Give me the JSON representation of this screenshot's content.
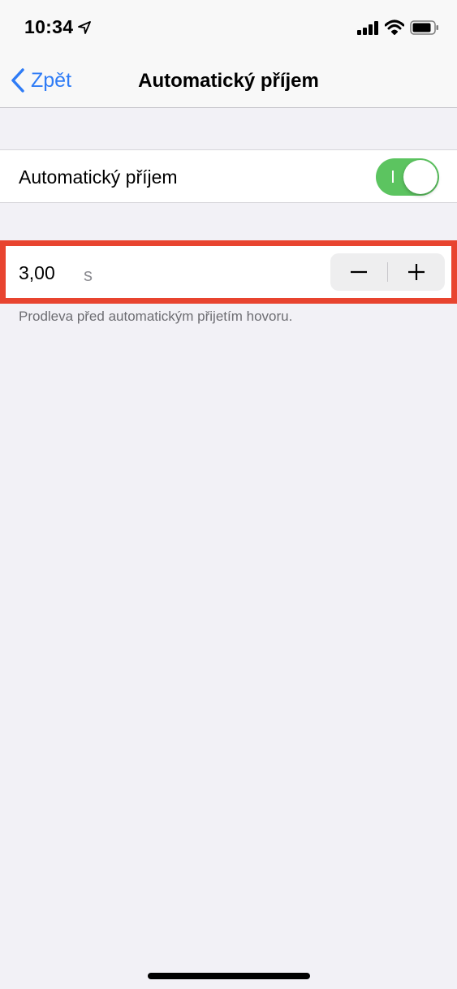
{
  "status_bar": {
    "time": "10:34",
    "icons": [
      "location-arrow-icon",
      "cellular-signal-icon",
      "wifi-icon",
      "battery-icon"
    ]
  },
  "nav": {
    "back_label": "Zpět",
    "title": "Automatický příjem"
  },
  "auto_answer": {
    "label": "Automatický příjem",
    "enabled": true
  },
  "delay": {
    "value": "3,00",
    "unit": "s",
    "decrement_icon": "minus-icon",
    "increment_icon": "plus-icon",
    "footnote": "Prodleva před automatickým přijetím hovoru."
  },
  "colors": {
    "accent": "#2f7cf6",
    "toggle_on": "#5cc460",
    "highlight": "#e8442f",
    "background": "#f2f1f6"
  }
}
